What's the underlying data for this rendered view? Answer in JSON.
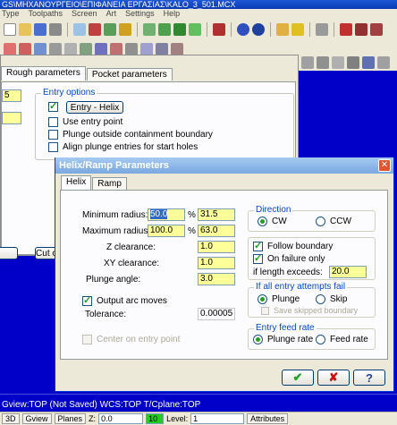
{
  "app": {
    "title": "GS\\ΜΗΧΑΝΟΥΡΓΕΙΟ\\ΕΠΙΦΑΝΕΙΑ ΕΡΓΑΣΙΑΣ\\KALO_3_501.MCX",
    "menu": [
      "Type",
      "Toolpaths",
      "Screen",
      "Art",
      "Settings",
      "Help"
    ]
  },
  "bg_dialog": {
    "tabs": [
      "Rough parameters",
      "Pocket parameters"
    ],
    "value_a": "5",
    "entry_options_title": "Entry options",
    "entry_helix_button": "Entry - Helix",
    "use_entry_point": "Use entry point",
    "plunge_outside": "Plunge outside containment boundary",
    "align_plunge": "Align plunge entries for start holes",
    "cut_button": "Cut o"
  },
  "helix": {
    "title": "Helix/Ramp Parameters",
    "tabs": [
      "Helix",
      "Ramp"
    ],
    "min_radius_label": "Minimum radius:",
    "min_radius_value": "50.0",
    "min_radius_pct": "%",
    "min_radius_abs": "31.5",
    "max_radius_label": "Maximum radius:",
    "max_radius_value": "100.0",
    "max_radius_pct": "%",
    "max_radius_abs": "63.0",
    "z_clearance_label": "Z clearance:",
    "z_clearance_value": "1.0",
    "xy_clearance_label": "XY clearance:",
    "xy_clearance_value": "1.0",
    "plunge_angle_label": "Plunge angle:",
    "plunge_angle_value": "3.0",
    "output_arc_label": "Output arc moves",
    "tolerance_label": "Tolerance:",
    "tolerance_value": "0.00005",
    "center_entry_label": "Center on entry point",
    "direction_title": "Direction",
    "cw": "CW",
    "ccw": "CCW",
    "follow_boundary": "Follow boundary",
    "on_failure_only": "On failure only",
    "if_length_exceeds": "if length exceeds:",
    "length_value": "20.0",
    "fail_title": "If all entry attempts fail",
    "plunge": "Plunge",
    "skip": "Skip",
    "save_skipped": "Save skipped boundary",
    "feed_title": "Entry feed rate",
    "plunge_rate": "Plunge rate",
    "feed_rate": "Feed rate",
    "ok": "✔",
    "cancel": "✘",
    "help": "?"
  },
  "status": {
    "line": "Gview:TOP (Not Saved)    WCS:TOP    T/Cplane:TOP",
    "buttons": [
      "3D",
      "Gview",
      "Planes"
    ],
    "z_label": "Z:",
    "z_value": "0.0",
    "level_value": "10",
    "level_label": "Level:",
    "level_field": "1",
    "attributes": "Attributes"
  },
  "colors": {
    "viewport": "#0000c8",
    "input_yellow": "#ffff99",
    "check_green": "#21a121",
    "group_title": "#0046d5"
  }
}
